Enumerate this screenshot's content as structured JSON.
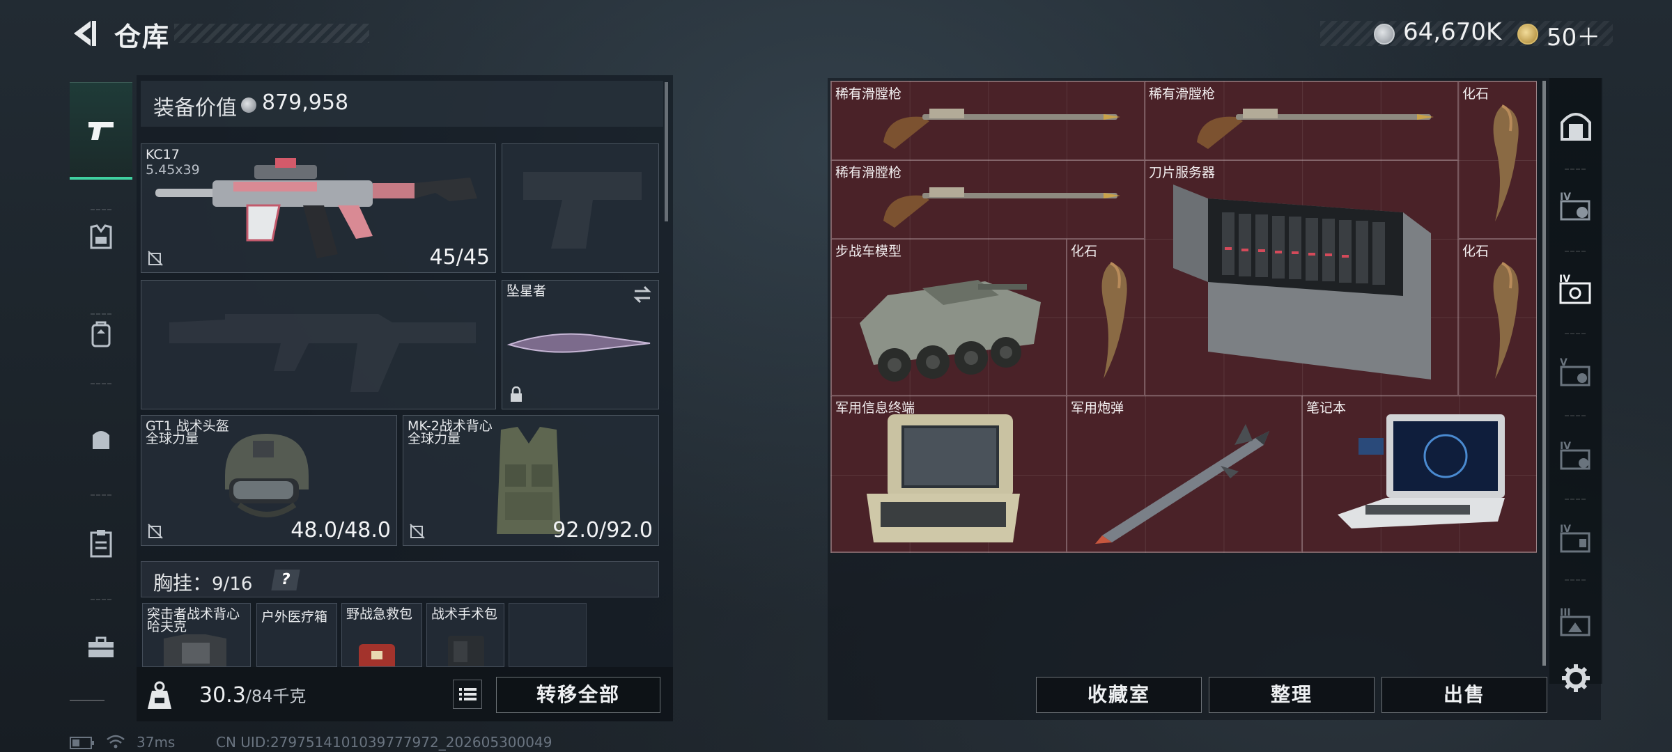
{
  "header": {
    "title": "仓库",
    "currency_primary": "64,670K",
    "currency_secondary": "50＋"
  },
  "sidebar_left": {
    "items": [
      {
        "icon": "pistol-icon",
        "active": true
      },
      {
        "icon": "helmet-icon",
        "active": false
      },
      {
        "icon": "backpack-icon",
        "active": false
      },
      {
        "icon": "bag-icon",
        "active": false
      },
      {
        "icon": "clipboard-icon",
        "active": false
      },
      {
        "icon": "toolbox-icon",
        "active": false
      }
    ]
  },
  "loadout": {
    "value_label": "装备价值",
    "value": "879,958",
    "primary_weapon": {
      "name": "KC17",
      "caliber": "5.45x39",
      "ammo": "45/45"
    },
    "melee": {
      "name": "坠星者"
    },
    "helmet": {
      "name": "GT1 战术头盔",
      "faction": "全球力量",
      "durability": "48.0/48.0"
    },
    "armor": {
      "name": "MK-2战术背心",
      "faction": "全球力量",
      "durability": "92.0/92.0"
    },
    "chest_rig": {
      "label": "胸挂：",
      "capacity": "9/16",
      "help": "?"
    },
    "rig_items": [
      {
        "name": "突击者战术背心",
        "sub": "哈夫克"
      },
      {
        "name": "户外医疗箱"
      },
      {
        "name": "野战急救包"
      },
      {
        "name": "战术手术包"
      }
    ]
  },
  "footer_left": {
    "weight": "30.3",
    "weight_max": "/84千克",
    "transfer_all": "转移全部"
  },
  "stash": {
    "items": [
      {
        "name": "稀有滑膛枪"
      },
      {
        "name": "稀有滑膛枪"
      },
      {
        "name": "化石"
      },
      {
        "name": "稀有滑膛枪"
      },
      {
        "name": "刀片服务器"
      },
      {
        "name": "步战车模型"
      },
      {
        "name": "化石"
      },
      {
        "name": "化石"
      },
      {
        "name": "军用信息终端"
      },
      {
        "name": "军用炮弹"
      },
      {
        "name": "笔记本"
      }
    ]
  },
  "footer_right": {
    "collection": "收藏室",
    "sort": "整理",
    "sell": "出售"
  },
  "sidebar_right": {
    "items": [
      {
        "icon": "safe-room-icon"
      },
      {
        "icon": "stash-tab-4a-icon",
        "label": "IV"
      },
      {
        "icon": "stash-tab-4b-icon",
        "label": "IV",
        "active": true
      },
      {
        "icon": "stash-tab-5-icon",
        "label": "V"
      },
      {
        "icon": "stash-tab-4c-icon",
        "label": "IV"
      },
      {
        "icon": "stash-tab-4d-icon",
        "label": "IV"
      },
      {
        "icon": "stash-tab-3-icon",
        "label": "III"
      }
    ]
  },
  "status_bar": {
    "ping": "37ms",
    "uid": "CN UID:2797514101039777972_202605300049"
  },
  "colors": {
    "accent": "#3fd0a0",
    "stash_bg": "#4a2228",
    "panel": "#141b22"
  }
}
